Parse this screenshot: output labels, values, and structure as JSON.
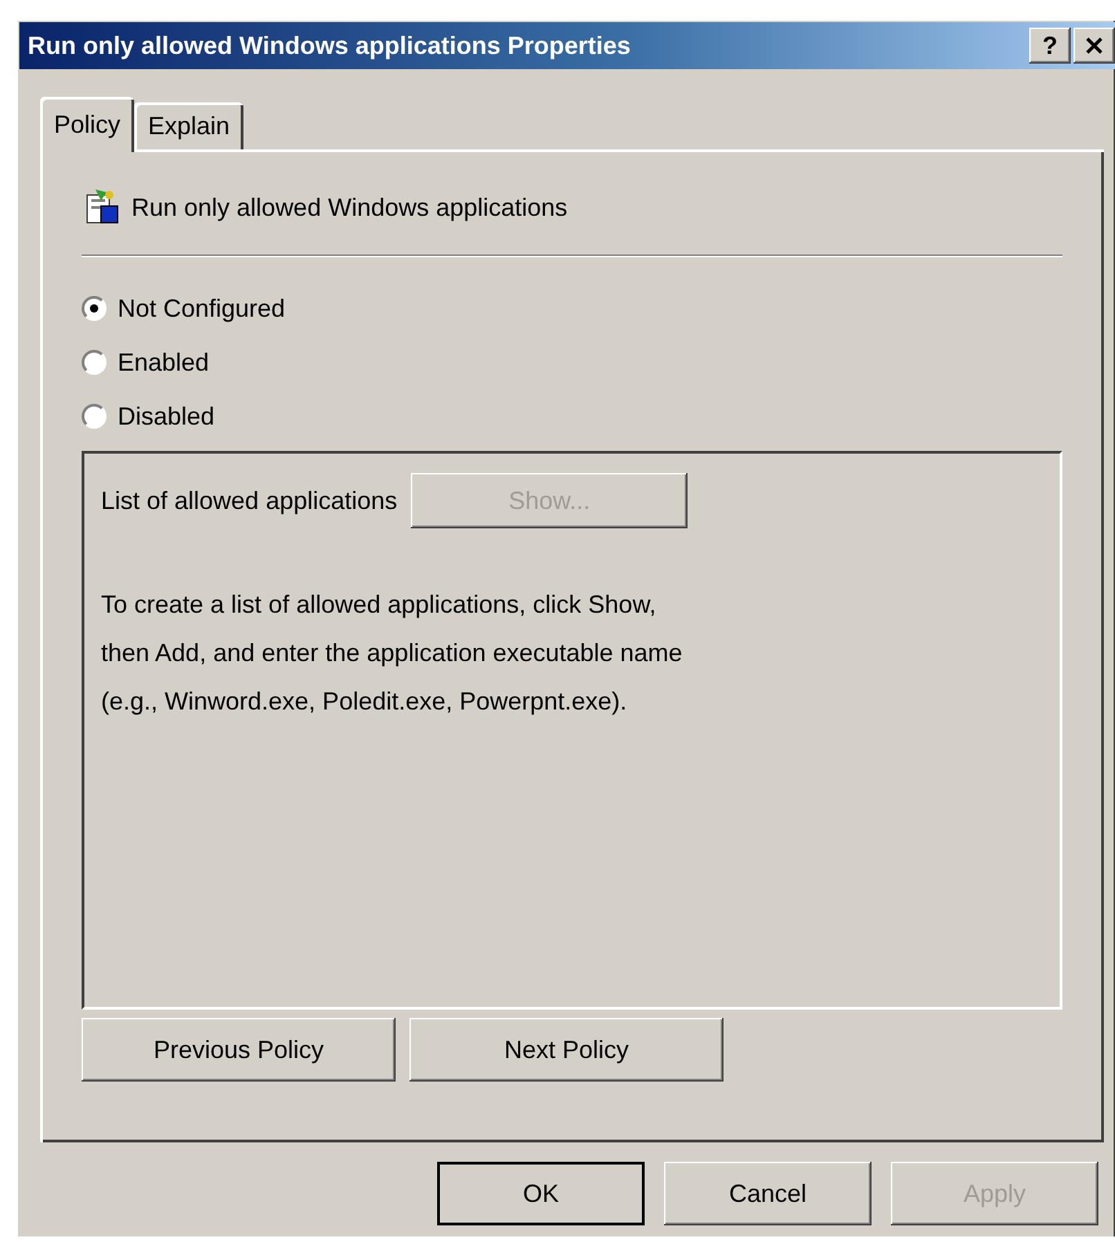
{
  "window": {
    "title": "Run only allowed Windows applications Properties",
    "help_button": "?"
  },
  "tabs": [
    {
      "label": "Policy",
      "selected": true
    },
    {
      "label": "Explain",
      "selected": false
    }
  ],
  "policy": {
    "title": "Run only allowed Windows applications"
  },
  "options": [
    {
      "label": "Not Configured",
      "selected": true
    },
    {
      "label": "Enabled",
      "selected": false
    },
    {
      "label": "Disabled",
      "selected": false
    }
  ],
  "settings": {
    "label": "List of allowed applications",
    "show_button": {
      "label": "Show...",
      "disabled": true
    },
    "description": "To create a list of allowed applications, click Show,\nthen Add, and enter the application executable name\n(e.g., Winword.exe, Poledit.exe, Powerpnt.exe)."
  },
  "nav_buttons": [
    {
      "label": "Previous Policy"
    },
    {
      "label": "Next Policy"
    }
  ],
  "dialog_buttons": [
    {
      "label": "OK",
      "default": true,
      "disabled": false
    },
    {
      "label": "Cancel",
      "default": false,
      "disabled": false
    },
    {
      "label": "Apply",
      "default": false,
      "disabled": true
    }
  ]
}
